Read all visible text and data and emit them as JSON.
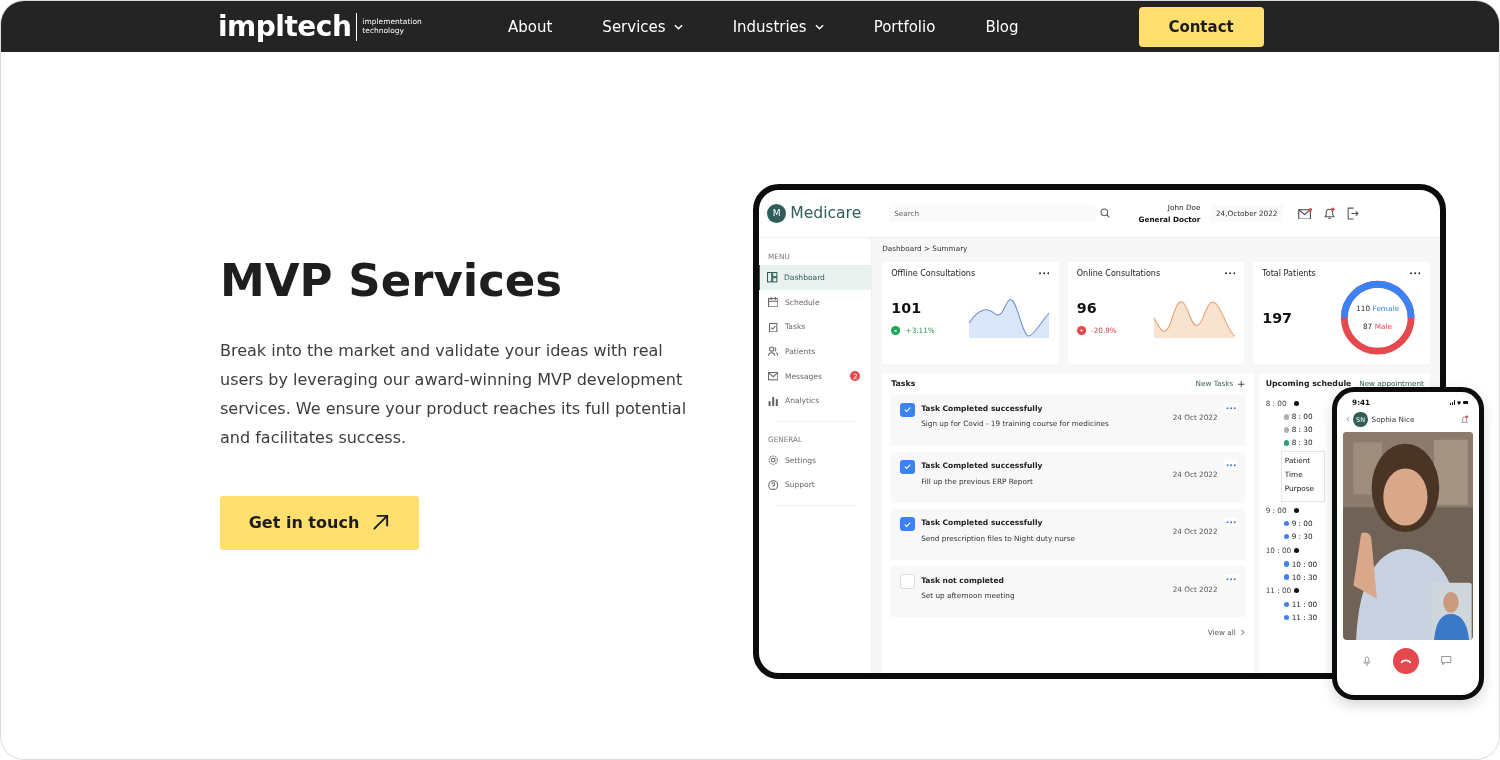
{
  "nav": {
    "logo": "impltech",
    "tagline": [
      "implementation",
      "technology"
    ],
    "links": [
      {
        "label": "About",
        "dropdown": false
      },
      {
        "label": "Services",
        "dropdown": true
      },
      {
        "label": "Industries",
        "dropdown": true
      },
      {
        "label": "Portfolio",
        "dropdown": false
      },
      {
        "label": "Blog",
        "dropdown": false
      }
    ],
    "cta": "Contact"
  },
  "hero": {
    "title": "MVP Services",
    "text": "Break into the market and validate your ideas with real users by leveraging our award-winning MVP development services. We ensure your product reaches its full potential and facilitates success.",
    "button": "Get in touch"
  },
  "tablet": {
    "brand": {
      "initial": "M",
      "name": "Medicare"
    },
    "search": {
      "placeholder": "Search"
    },
    "user": {
      "name": "John Doe",
      "role": "General Doctor"
    },
    "date": "24,October 2022",
    "sidebar": [
      {
        "heading": "MENU",
        "items": [
          {
            "label": "Dashboard",
            "selected": true
          },
          {
            "label": "Schedule",
            "selected": false
          },
          {
            "label": "Tasks",
            "selected": false
          },
          {
            "label": "Patients",
            "selected": false
          },
          {
            "label": "Messages",
            "selected": false,
            "badge": "2"
          },
          {
            "label": "Analytics",
            "selected": false
          }
        ]
      },
      {
        "heading": "GENERAL",
        "items": [
          {
            "label": "Settings",
            "selected": false
          },
          {
            "label": "Support",
            "selected": false
          }
        ]
      }
    ],
    "breadcrumb": "Dashboard > Summary",
    "stats": [
      {
        "kind": "sparkline",
        "title": "Offline Consultations",
        "value": "101",
        "change": "+3.11%",
        "positive": true
      },
      {
        "kind": "sparkline",
        "title": "Online Consultations",
        "value": "96",
        "change": "-20.9%",
        "positive": false
      },
      {
        "kind": "donut",
        "title": "Total Patients",
        "value": "197",
        "legend": [
          {
            "value": "110",
            "label": "Female",
            "color": "#3b82f6"
          },
          {
            "value": "87",
            "label": "Male",
            "color": "#e5484d"
          }
        ]
      }
    ],
    "tasks": {
      "title": "Tasks",
      "action": "New Tasks",
      "items": [
        {
          "title": "Task Completed successfully",
          "detail": "Sign up for Covid - 19 training course for medicines",
          "date": "24 Oct 2022",
          "checked": true
        },
        {
          "title": "Task Completed successfully",
          "detail": "Fill up the previous ERP Report",
          "date": "24 Oct 2022",
          "checked": true
        },
        {
          "title": "Task Completed successfully",
          "detail": "Send prescription files to Night duty nurse",
          "date": "24 Oct 2022",
          "checked": true
        },
        {
          "title": "Task not completed",
          "detail": "Set up afternoon meeting",
          "date": "24 Oct 2022",
          "checked": false
        }
      ],
      "footer": "View all"
    },
    "schedule": {
      "title": "Upcoming schedule",
      "action": "New appointment",
      "hours": [
        {
          "time": "8 : 00",
          "slots": [
            {
              "time": "8 : 00",
              "color": "#b0b0b0"
            },
            {
              "time": "8 : 30",
              "color": "#b0b0b0"
            },
            {
              "time": "8 : 30",
              "color": "#2e9e6a"
            }
          ],
          "popup": [
            "Patient",
            "Time",
            "Purpose"
          ]
        },
        {
          "time": "9 : 00",
          "slots": [
            {
              "time": "9 : 00",
              "color": "#3b82f6"
            },
            {
              "time": "9 : 30",
              "color": "#3b82f6"
            }
          ]
        },
        {
          "time": "10 : 00",
          "slots": [
            {
              "time": "10 : 00",
              "color": "#3b82f6"
            },
            {
              "time": "10 : 30",
              "color": "#3b82f6"
            }
          ]
        },
        {
          "time": "11 : 00",
          "slots": [
            {
              "time": "11 : 00",
              "color": "#3b82f6"
            },
            {
              "time": "11 : 30",
              "color": "#3b82f6"
            }
          ]
        }
      ]
    }
  },
  "phone": {
    "time": "9:41",
    "contact": {
      "initials": "SN",
      "name": "Sophia Nice"
    }
  }
}
